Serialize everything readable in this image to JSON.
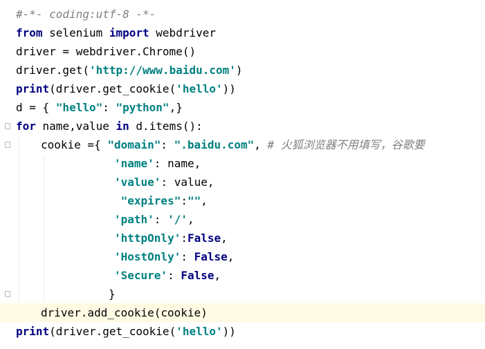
{
  "lines": [
    {
      "indent": 0,
      "tokens": [
        {
          "t": "#-*- coding:utf-8 -*-",
          "c": "cm"
        }
      ]
    },
    {
      "indent": 0,
      "tokens": [
        {
          "t": "from",
          "c": "kw"
        },
        {
          "t": " selenium ",
          "c": "plain"
        },
        {
          "t": "import",
          "c": "kw"
        },
        {
          "t": " webdriver",
          "c": "plain"
        }
      ]
    },
    {
      "indent": 0,
      "tokens": [
        {
          "t": "driver = webdriver.Chrome()",
          "c": "plain"
        }
      ]
    },
    {
      "indent": 0,
      "tokens": [
        {
          "t": "driver.get(",
          "c": "plain"
        },
        {
          "t": "'http://www.baidu.com'",
          "c": "str"
        },
        {
          "t": ")",
          "c": "plain"
        }
      ]
    },
    {
      "indent": 0,
      "tokens": [
        {
          "t": "print",
          "c": "kw"
        },
        {
          "t": "(driver.get_cookie(",
          "c": "plain"
        },
        {
          "t": "'hello'",
          "c": "str"
        },
        {
          "t": "))",
          "c": "plain"
        }
      ]
    },
    {
      "indent": 0,
      "tokens": [
        {
          "t": "d = { ",
          "c": "plain"
        },
        {
          "t": "\"hello\"",
          "c": "str"
        },
        {
          "t": ": ",
          "c": "plain"
        },
        {
          "t": "\"python\"",
          "c": "str"
        },
        {
          "t": ",}",
          "c": "plain"
        }
      ]
    },
    {
      "indent": 0,
      "tokens": [
        {
          "t": "for",
          "c": "kw"
        },
        {
          "t": " name,value ",
          "c": "plain"
        },
        {
          "t": "in",
          "c": "kw"
        },
        {
          "t": " d.items():",
          "c": "plain"
        }
      ]
    },
    {
      "indent": 1,
      "tokens": [
        {
          "t": "cookie ={ ",
          "c": "plain"
        },
        {
          "t": "\"domain\"",
          "c": "str"
        },
        {
          "t": ": ",
          "c": "plain"
        },
        {
          "t": "\".baidu.com\"",
          "c": "str"
        },
        {
          "t": ", ",
          "c": "plain"
        },
        {
          "t": "# 火狐浏览器不用填写，谷歌要",
          "c": "cm"
        }
      ]
    },
    {
      "indent": 2,
      "tokens": [
        {
          "t": "'name'",
          "c": "str"
        },
        {
          "t": ": name,",
          "c": "plain"
        }
      ]
    },
    {
      "indent": 2,
      "tokens": [
        {
          "t": "'value'",
          "c": "str"
        },
        {
          "t": ": value,",
          "c": "plain"
        }
      ]
    },
    {
      "indent": 2,
      "tokens": [
        {
          "t": " \"expires\"",
          "c": "str"
        },
        {
          "t": ":",
          "c": "plain"
        },
        {
          "t": "\"\"",
          "c": "str"
        },
        {
          "t": ",",
          "c": "plain"
        }
      ]
    },
    {
      "indent": 2,
      "tokens": [
        {
          "t": "'path'",
          "c": "str"
        },
        {
          "t": ": ",
          "c": "plain"
        },
        {
          "t": "'/'",
          "c": "str"
        },
        {
          "t": ",",
          "c": "plain"
        }
      ]
    },
    {
      "indent": 2,
      "tokens": [
        {
          "t": "'httpOnly'",
          "c": "str"
        },
        {
          "t": ":",
          "c": "plain"
        },
        {
          "t": "False",
          "c": "const"
        },
        {
          "t": ",",
          "c": "plain"
        }
      ]
    },
    {
      "indent": 2,
      "tokens": [
        {
          "t": "'HostOnly'",
          "c": "str"
        },
        {
          "t": ": ",
          "c": "plain"
        },
        {
          "t": "False",
          "c": "const"
        },
        {
          "t": ",",
          "c": "plain"
        }
      ]
    },
    {
      "indent": 2,
      "tokens": [
        {
          "t": "'Secure'",
          "c": "str"
        },
        {
          "t": ": ",
          "c": "plain"
        },
        {
          "t": "False",
          "c": "const"
        },
        {
          "t": ",",
          "c": "plain"
        }
      ]
    },
    {
      "indent": 3,
      "tokens": [
        {
          "t": "}",
          "c": "plain"
        }
      ]
    },
    {
      "indent": 1,
      "current": true,
      "tokens": [
        {
          "t": "driver.add_cookie(cookie)",
          "c": "plain"
        }
      ]
    },
    {
      "indent": 0,
      "tokens": [
        {
          "t": "print",
          "c": "kw"
        },
        {
          "t": "(driver.get_cookie(",
          "c": "plain"
        },
        {
          "t": "'hello'",
          "c": "str"
        },
        {
          "t": "))",
          "c": "plain"
        }
      ]
    }
  ]
}
